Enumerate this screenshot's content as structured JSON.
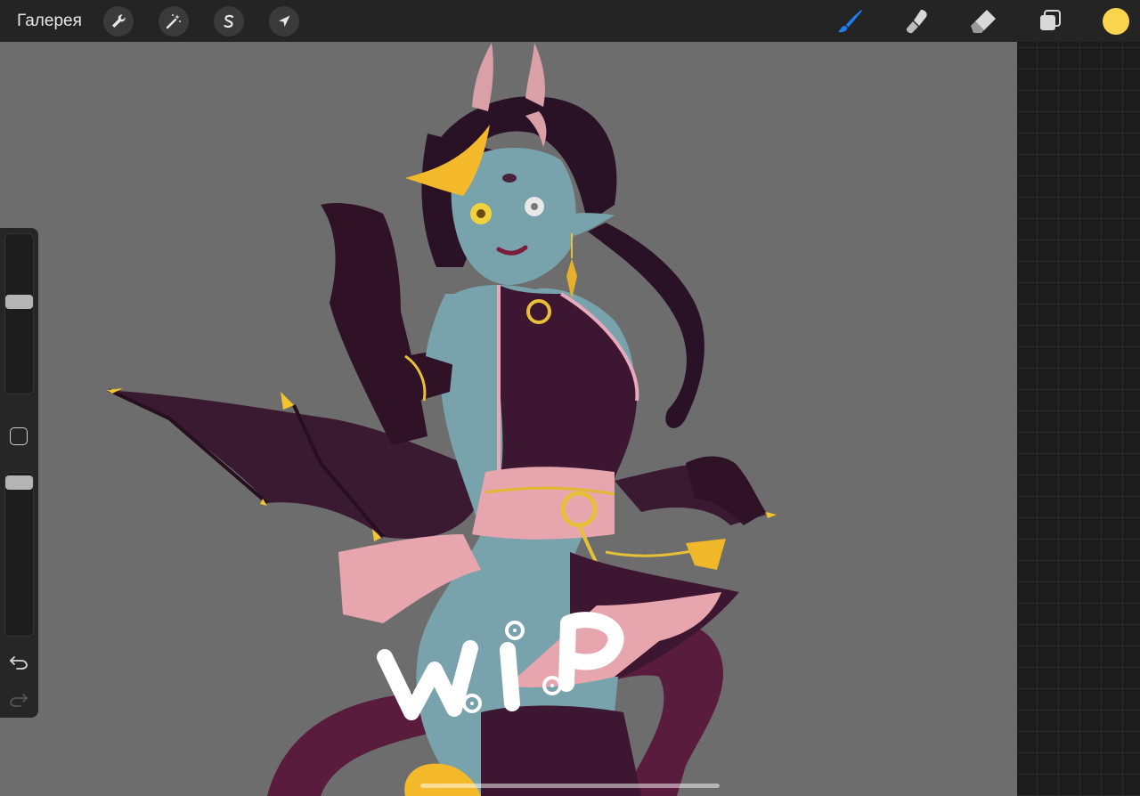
{
  "toolbar": {
    "gallery_label": "Галерея",
    "left_tools": [
      "wrench-icon",
      "magic-wand-icon",
      "selection-s-icon",
      "move-arrow-icon"
    ],
    "right_tools": [
      "brush-icon",
      "smudge-icon",
      "eraser-icon",
      "layers-icon"
    ],
    "active_tool": "brush-icon",
    "current_color": "#fcd44d",
    "accent": "#1e7ef5"
  },
  "canvas": {
    "watermark_text": "W.I.P",
    "background": "#6d6d6d"
  },
  "sidebar": {
    "brush_size_level": 0.58,
    "opacity_level": 0.98
  }
}
